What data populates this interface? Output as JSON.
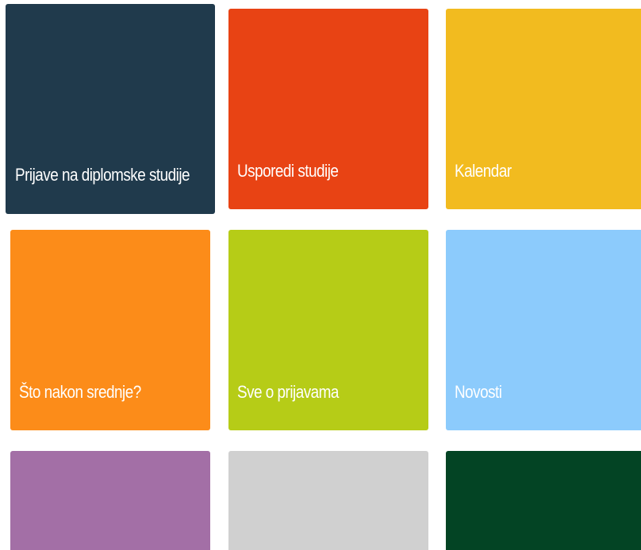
{
  "tiles": [
    {
      "label": "Prijave na diplomske studije",
      "color": "#203a4c"
    },
    {
      "label": "Usporedi studije",
      "color": "#e84314"
    },
    {
      "label": "Kalendar",
      "color": "#f2bb1f"
    },
    {
      "label": "Što nakon srednje?",
      "color": "#fc8c19"
    },
    {
      "label": "Sve o prijavama",
      "color": "#b6cc17"
    },
    {
      "label": "Novosti",
      "color": "#8ccbfc"
    },
    {
      "label": "",
      "color": "#a36fa6"
    },
    {
      "label": "",
      "color": "#d0d0d0"
    },
    {
      "label": "",
      "color": "#034424"
    }
  ]
}
